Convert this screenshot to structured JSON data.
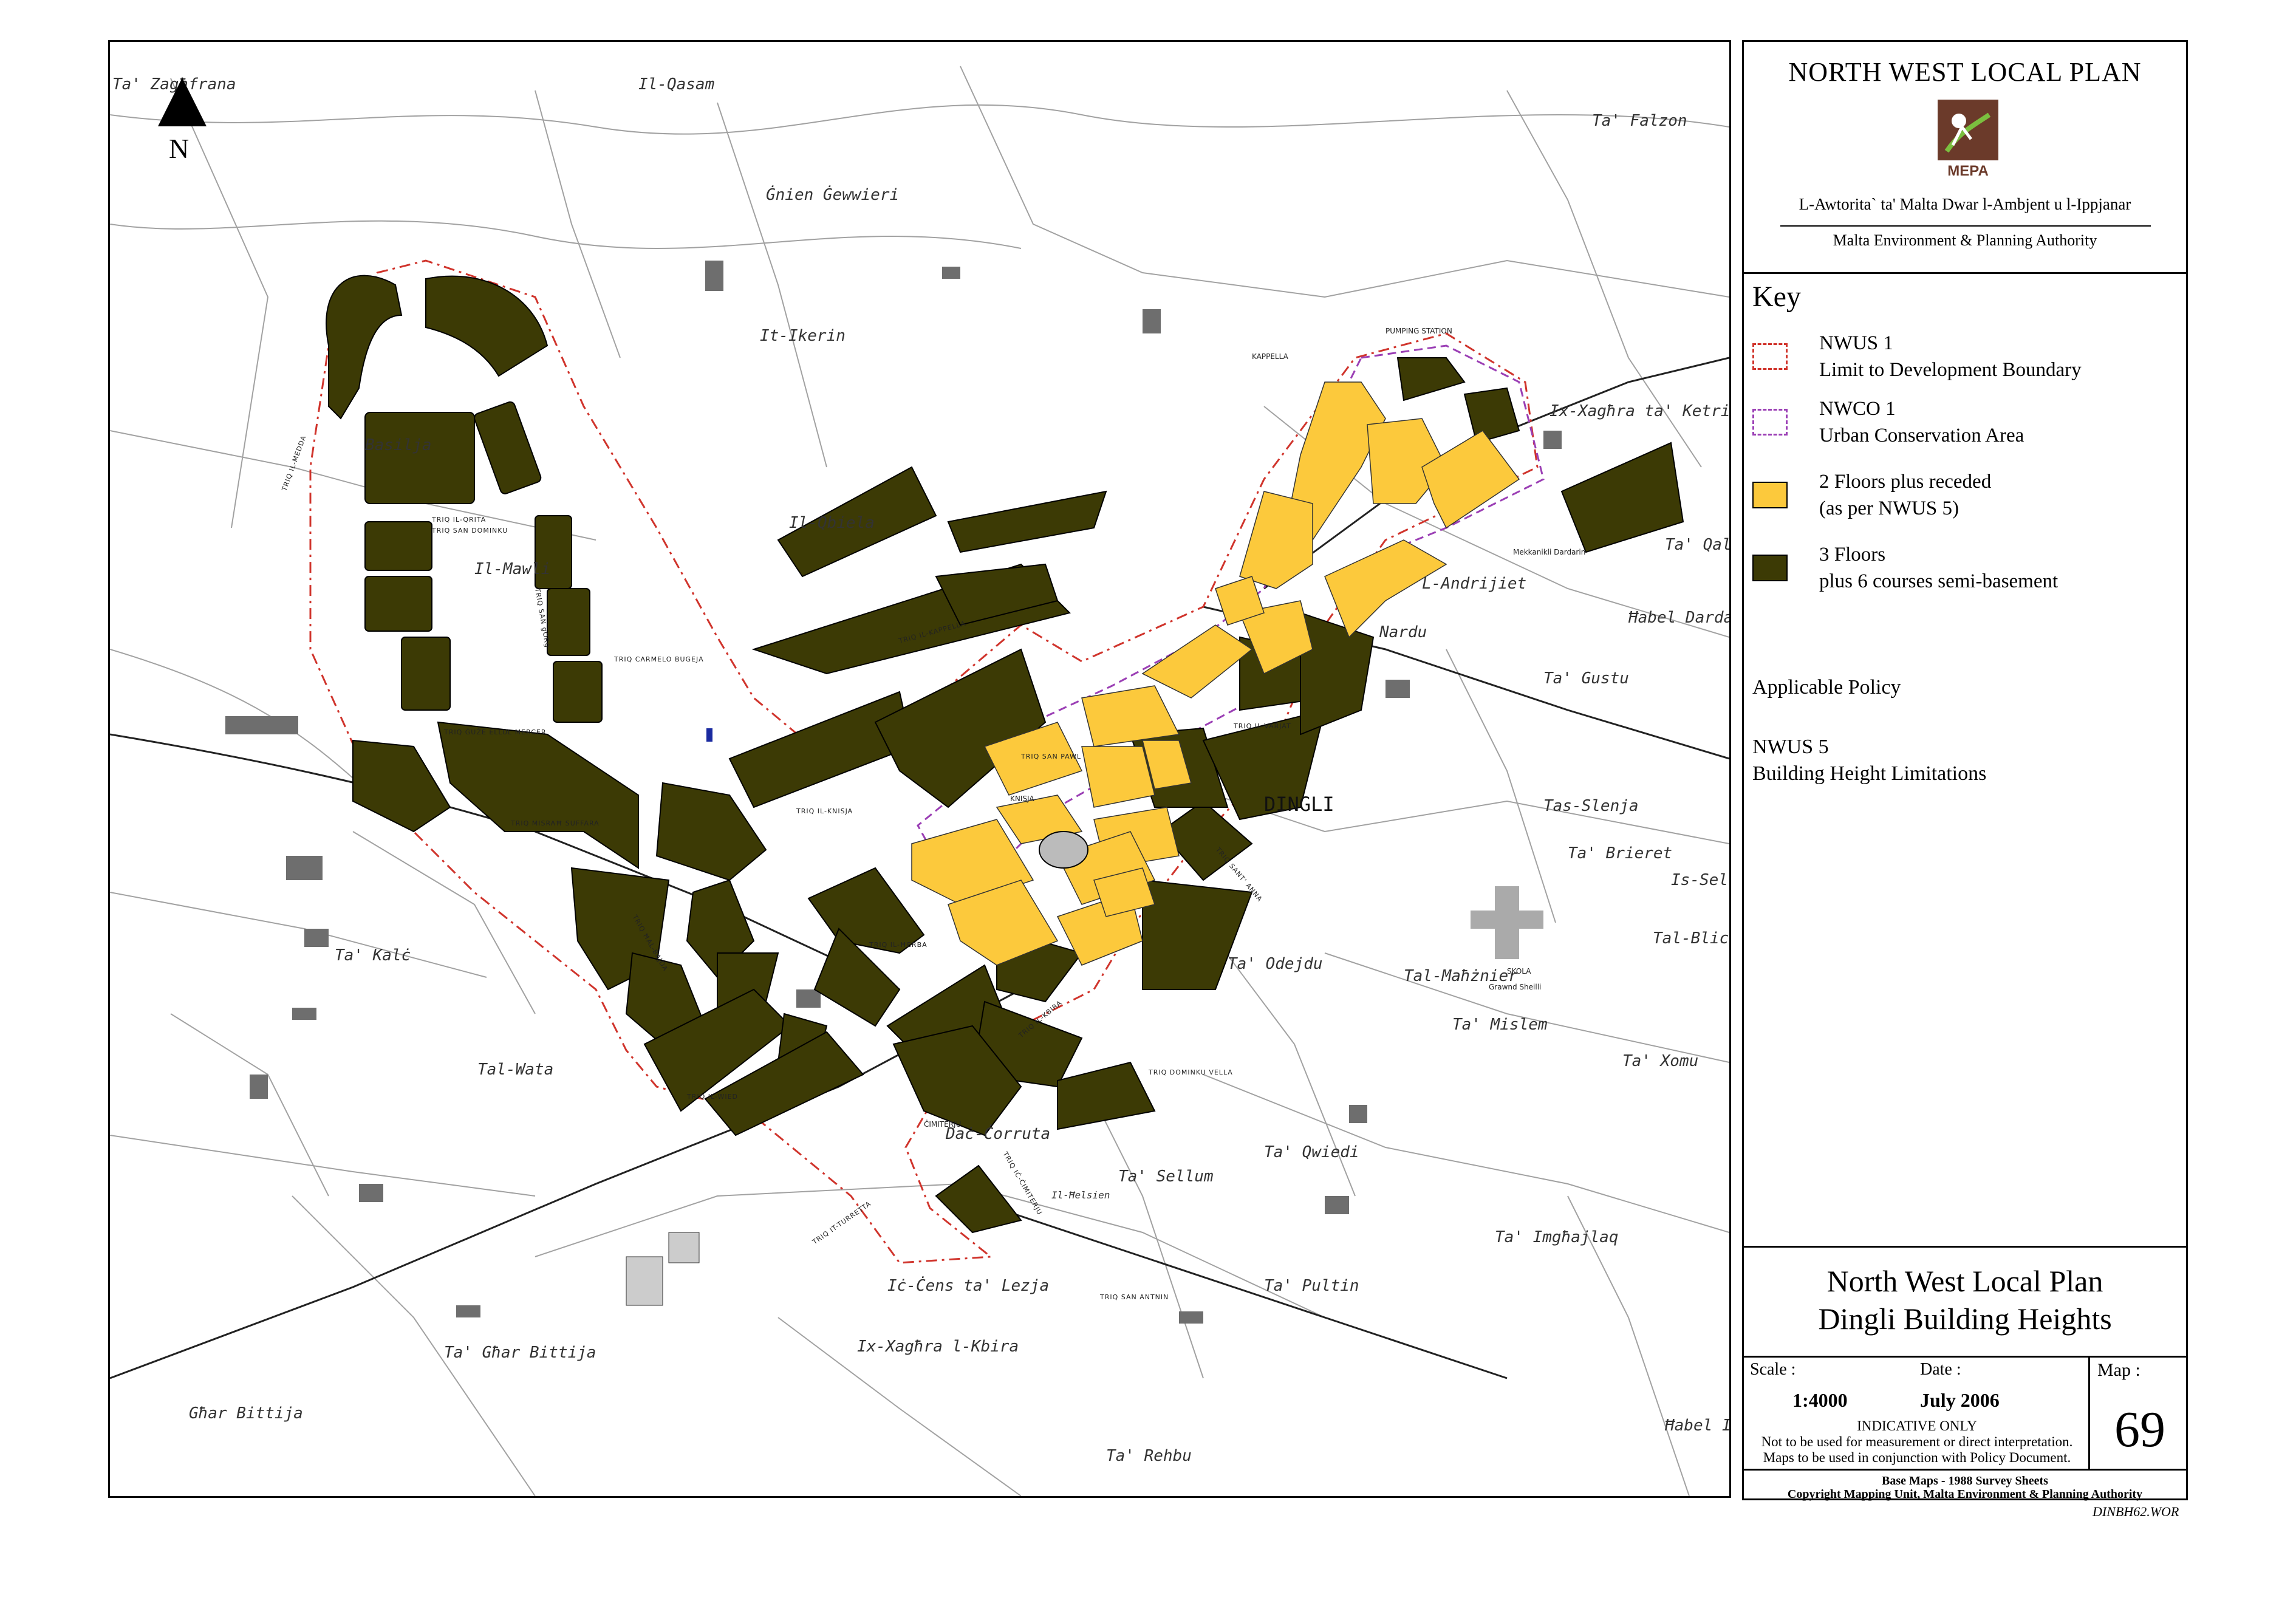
{
  "map": {
    "north_letter": "N",
    "place_labels": [
      "Ta' Zagħfrana",
      "Il-Qasam",
      "Ġnien Ġewwieri",
      "It-Ikerin",
      "Basilja",
      "Il-Mawli",
      "Il-Qbiela",
      "Ta' Falzon",
      "Ix-Xagħra ta' Ketrin",
      "Ta' Qali",
      "L-Andrijiet",
      "Nardu",
      "Ħabel Dardarin",
      "Ta' Gustu",
      "DINGLI",
      "Tas-Slenja",
      "Ta' Brieret",
      "Is-Sellum",
      "Tal-Blicċ",
      "Ta' Kalċ",
      "Ta' Odejdu",
      "Tal-Maħżnier",
      "Ta' Mislem",
      "Ta' Xomu",
      "Tal-Wata",
      "Ta' Qwiedi",
      "Daċ-Ċorruta",
      "Ta' Għar Bittija",
      "Ta' Pultin",
      "Ta' Imgħajlaq",
      "Iċ-Ċens ta' Lezja",
      "Ix-Xagħra l-Kbira",
      "Għar Bittija",
      "Ta' Rehbu",
      "Ħabel Ix",
      "Il-Ħelsien",
      "Ta' Sellum"
    ],
    "feature_labels": [
      "KAPPELLA",
      "PUMPING STATION",
      "KNISJA",
      "SKOLA",
      "ĊIMITERJU",
      "Grawnd Sheilli",
      "Mekkanikli Dardarin"
    ],
    "street_labels": [
      "TRIQ IL-MEDDA",
      "TRIQ IL-QRITA",
      "TRIQ SAN DOMINKU",
      "TRIQ SAN ġORġ",
      "TRIQ ĠUŻE ELLUL MERCER",
      "TRIQ MISRAĦ SUFFARA",
      "TRIQ IL-KNISJA",
      "TRIQ IL-KAPPELLA",
      "TRIQ IL-VARJAT",
      "TRIQ IL-KBIRA",
      "TRIQ SAN PAWL",
      "TRIQ IT-TURRETTA",
      "TRIQ IL-WIED",
      "TRIQ IĊ-ĊIMITERJU",
      "TRIQ IL-ĦERBA",
      "TRIQ DOMINKU VELLA",
      "TRIQ SAN ANTNIN",
      "TRIQ ĦAL-BAJDA",
      "TRIQ CARMELO BUGEJA",
      "TRIQ SANT' ANNA"
    ]
  },
  "panel": {
    "plan_title": "NORTH WEST LOCAL PLAN",
    "logo_text": "MEPA",
    "authority_mt": "L-Awtorita` ta' Malta Dwar l-Ambjent u l-Ippjanar",
    "authority_en": "Malta Environment & Planning Authority",
    "key_title": "Key",
    "key": [
      {
        "line1": "NWUS 1",
        "line2": "Limit to Development Boundary"
      },
      {
        "line1": "NWCO 1",
        "line2": "Urban Conservation Area"
      },
      {
        "line1": "2 Floors plus receded",
        "line2": "(as per NWUS 5)"
      },
      {
        "line1": "3 Floors",
        "line2": "plus 6 courses semi-basement"
      }
    ],
    "policy_title": "Applicable Policy",
    "policy_code": "NWUS 5",
    "policy_name": "Building Height Limitations",
    "map_title_1": "North West Local Plan",
    "map_title_2": "Dingli Building Heights",
    "scale_label": "Scale :",
    "scale_value": "1:4000",
    "date_label": "Date :",
    "date_value": "July 2006",
    "indicative_1": "INDICATIVE ONLY",
    "indicative_2": "Not to be used for measurement or direct interpretation.",
    "indicative_3": "Maps to be used in conjunction with Policy Document.",
    "map_label": "Map :",
    "map_number": "69",
    "base_maps": "Base Maps - 1988 Survey Sheets",
    "copyright": "Copyright Mapping Unit, Malta Environment & Planning Authority",
    "file_code": "DINBH62.WOR"
  },
  "colors": {
    "three_floors": "#3c3a05",
    "two_floors_receded": "#fcc93c",
    "development_boundary": "#d0342c",
    "conservation_area": "#9b3fb5",
    "building_grey": "#6e6e6e"
  }
}
